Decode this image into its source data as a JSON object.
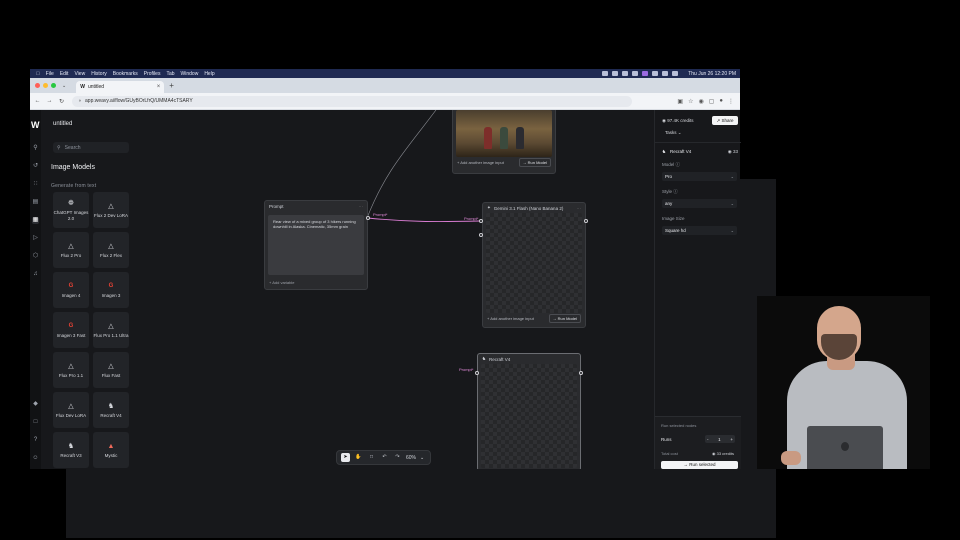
{
  "menubar": {
    "items": [
      "Chrome",
      "File",
      "Edit",
      "View",
      "History",
      "Bookmarks",
      "Profiles",
      "Tab",
      "Window",
      "Help"
    ],
    "clock": "Thu Jun 26  12:20 PM"
  },
  "browser": {
    "tab_title": "untitled",
    "url": "app.weavy.ai/flow/GUyBOrLfrQ/UMMA4cTSARY"
  },
  "sidebar": {
    "doc_title": "untitled",
    "search_placeholder": "Search",
    "section_title": "Image Models",
    "section_sub": "Generate from text",
    "models": [
      {
        "label": "ChatGPT Images 2.0",
        "icon": "openai-icon"
      },
      {
        "label": "Flux 2 Dev LoRA",
        "icon": "flux-icon"
      },
      {
        "label": "Flux 2 Pro",
        "icon": "flux-icon"
      },
      {
        "label": "Flux 2 Flex",
        "icon": "flux-icon"
      },
      {
        "label": "Imagen 4",
        "icon": "google-icon"
      },
      {
        "label": "Imagen 3",
        "icon": "google-icon"
      },
      {
        "label": "Imagen 3 Fast",
        "icon": "google-icon"
      },
      {
        "label": "Flux Pro 1.1 Ultra",
        "icon": "flux-icon"
      },
      {
        "label": "Flux Pro 1.1",
        "icon": "flux-icon"
      },
      {
        "label": "Flux Fast",
        "icon": "flux-icon"
      },
      {
        "label": "Flux Dev LoRA",
        "icon": "flux-icon"
      },
      {
        "label": "Recraft V4",
        "icon": "recraft-icon"
      },
      {
        "label": "Recraft V3",
        "icon": "recraft-icon"
      },
      {
        "label": "Mystic",
        "icon": "mystic-icon"
      }
    ]
  },
  "canvas": {
    "prompt_node": {
      "title": "Prompt",
      "text": "Rear view of a mixed group of 3 hikers running downhill in Alaska. Cinematic, 35mm grain",
      "add_variable": "+ Add variable",
      "port_label": "Prompt*"
    },
    "image_node_top": {
      "add_input": "+ Add another image input",
      "run": "→ Run Model"
    },
    "gemini_node": {
      "title": "Gemini 3.1 Flash (Nano Banana 2)",
      "port_label": "Prompt*",
      "add_input": "+ Add another image input",
      "run": "→ Run Model"
    },
    "recraft_node": {
      "title": "Recraft V4",
      "port_label": "Prompt*"
    },
    "zoom": "60%"
  },
  "right_panel": {
    "credits": "97.4K credits",
    "share": "Share",
    "tasks": "Tasks",
    "model_name": "Recraft V4",
    "model_cost": "33",
    "model_label": "Model",
    "model_value": "Pro",
    "style_label": "Style",
    "style_value": "any",
    "size_label": "Image Size",
    "size_value": "Square hd",
    "run_title": "Run selected nodes",
    "runs_label": "Runs",
    "runs_value": "1",
    "total_cost_label": "Total cost",
    "total_cost_value": "33 credits",
    "run_selected": "→ Run selected"
  }
}
